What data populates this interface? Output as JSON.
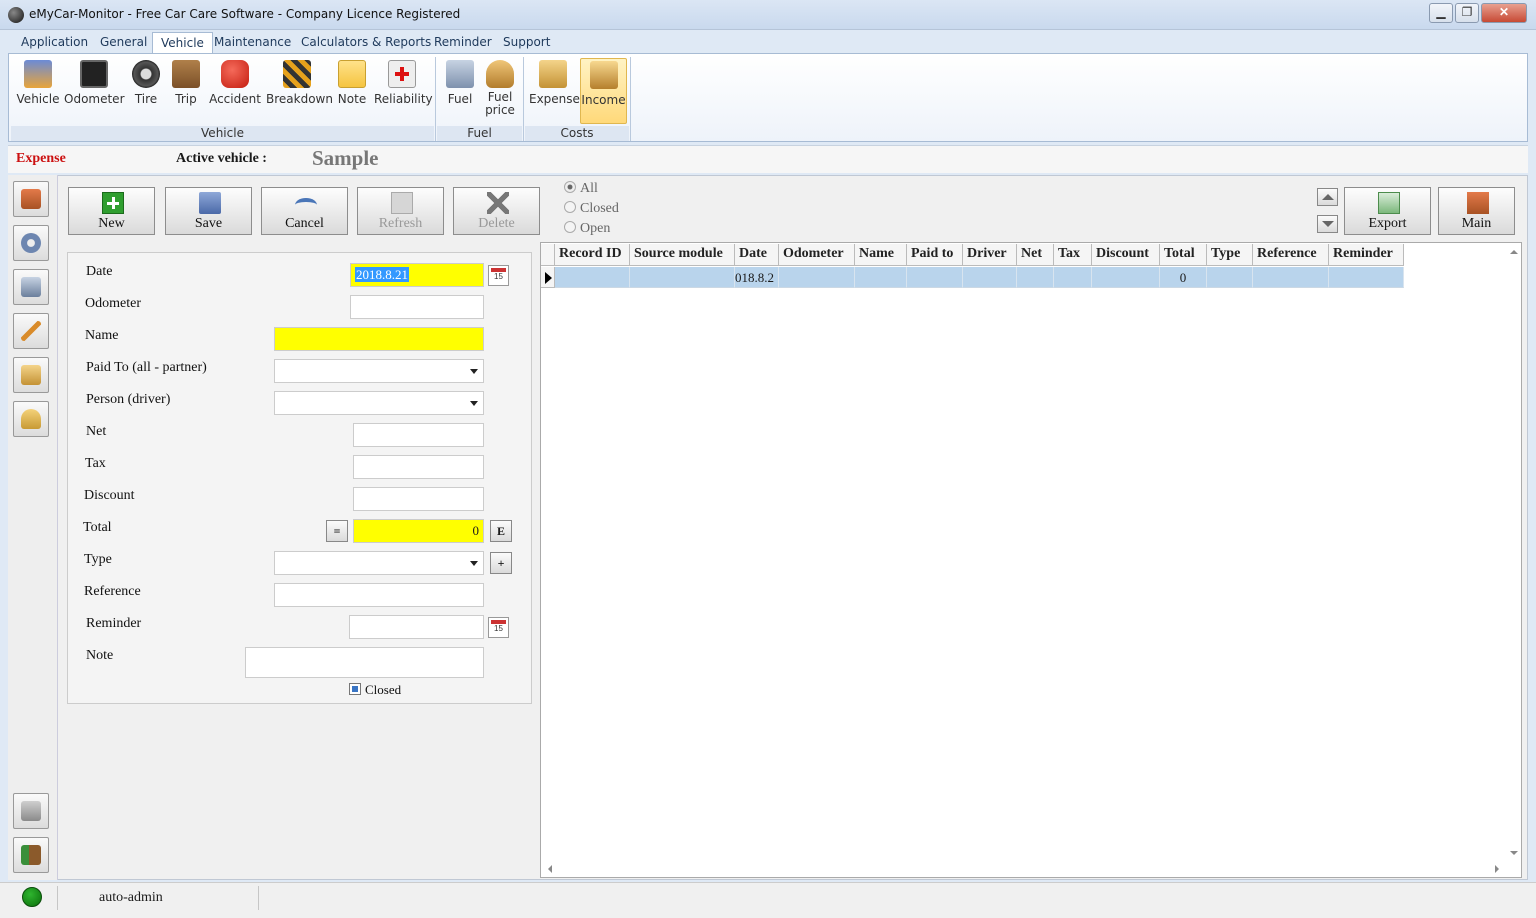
{
  "window": {
    "title": "eMyCar-Monitor - Free Car Care Software - Company Licence Registered",
    "minimize": "▁",
    "maximize": "❐",
    "close": "✕"
  },
  "menu": [
    "Application",
    "General",
    "Vehicle",
    "Maintenance",
    "Calculators & Reports",
    "Reminder",
    "Support"
  ],
  "ribbon": {
    "vehicle_buttons": [
      {
        "label": "Vehicle",
        "icon": "truck-icon"
      },
      {
        "label": "Odometer",
        "icon": "odometer-icon"
      },
      {
        "label": "Tire",
        "icon": "tire-icon"
      },
      {
        "label": "Trip",
        "icon": "suitcase-icon"
      },
      {
        "label": "Accident",
        "icon": "stop-sign-icon"
      },
      {
        "label": "Breakdown",
        "icon": "barrier-icon"
      },
      {
        "label": "Note",
        "icon": "note-icon"
      },
      {
        "label": "Reliability",
        "icon": "first-aid-icon"
      }
    ],
    "fuel_buttons": [
      {
        "label": "Fuel",
        "icon": "fuel-pump-icon"
      },
      {
        "label": "Fuel",
        "label2": "price",
        "icon": "coins-icon"
      }
    ],
    "cost_buttons": [
      {
        "label": "Expense",
        "icon": "coins-stack-icon"
      },
      {
        "label": "Income",
        "icon": "income-icon"
      }
    ],
    "groups": [
      "Vehicle",
      "Fuel",
      "Costs"
    ]
  },
  "strip": {
    "section": "Expense",
    "active_label": "Active vehicle :",
    "active_vehicle": "Sample"
  },
  "toolbar": {
    "new": "New",
    "save": "Save",
    "cancel": "Cancel",
    "refresh": "Refresh",
    "delete": "Delete",
    "export": "Export",
    "main": "Main"
  },
  "filter": {
    "options": [
      "All",
      "Closed",
      "Open"
    ],
    "selected": "All"
  },
  "form": {
    "date_label": "Date",
    "date_value": "2018.8.21",
    "odometer_label": "Odometer",
    "name_label": "Name",
    "paid_to_label": "Paid To (all - partner)",
    "person_label": "Person (driver)",
    "net_label": "Net",
    "tax_label": "Tax",
    "discount_label": "Discount",
    "total_label": "Total",
    "total_value": "0",
    "equals_btn": "=",
    "e_btn": "E",
    "type_label": "Type",
    "type_add_btn": "+",
    "reference_label": "Reference",
    "reminder_label": "Reminder",
    "note_label": "Note",
    "closed_label": "Closed",
    "calendar_num": "15"
  },
  "grid": {
    "columns": [
      "Record ID",
      "Source module",
      "Date",
      "Odometer",
      "Name",
      "Paid to",
      "Driver",
      "Net",
      "Tax",
      "Discount",
      "Total",
      "Type",
      "Reference",
      "Reminder"
    ],
    "rows": [
      [
        "",
        "",
        "018.8.2",
        "",
        "",
        "",
        "",
        "",
        "",
        "",
        "0",
        "",
        "",
        ""
      ]
    ]
  },
  "status": {
    "user": "auto-admin"
  }
}
